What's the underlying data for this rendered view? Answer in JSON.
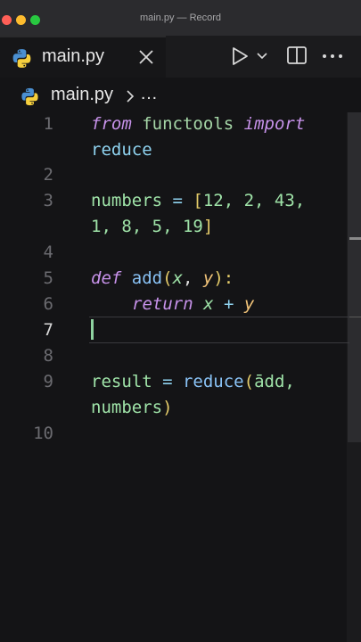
{
  "window": {
    "title": "main.py — Record"
  },
  "tab": {
    "label": "main.py"
  },
  "breadcrumb": {
    "file": "main.py",
    "more": "…"
  },
  "gutter": [
    "1",
    "2",
    "3",
    "4",
    "5",
    "6",
    "7",
    "8",
    "9",
    "10"
  ],
  "code": {
    "l1_from": "from",
    "l1_functools": "functools",
    "l1_import": "import",
    "l1b_reduce": "reduce",
    "l3_numbers": "numbers",
    "l3_eq": " = ",
    "l3_open": "[",
    "l3_vals1": "12, 2, 43,",
    "l3b_vals2": "1, 8, 5, 19",
    "l3b_close": "]",
    "l5_def": "def",
    "l5_add": "add",
    "l5_open": "(",
    "l5_x": "x",
    "l5_comma": ", ",
    "l5_y": "y",
    "l5_close": "):",
    "l6_return": "return",
    "l6_x": "x",
    "l6_plus": " + ",
    "l6_y": "y",
    "l9_result": "result",
    "l9_eq": " = ",
    "l9_reduce": "reduce",
    "l9_open": "(",
    "l9_add": "ādd,",
    "l9b_numbers": "numbers",
    "l9b_close": ")"
  },
  "icons": {
    "python": "python-icon",
    "close": "close-icon",
    "run": "play-icon",
    "split": "split-editor-icon",
    "more": "ellipsis-icon"
  },
  "colors": {
    "accent_cursor": "#8fd3a0",
    "background": "#141416"
  }
}
